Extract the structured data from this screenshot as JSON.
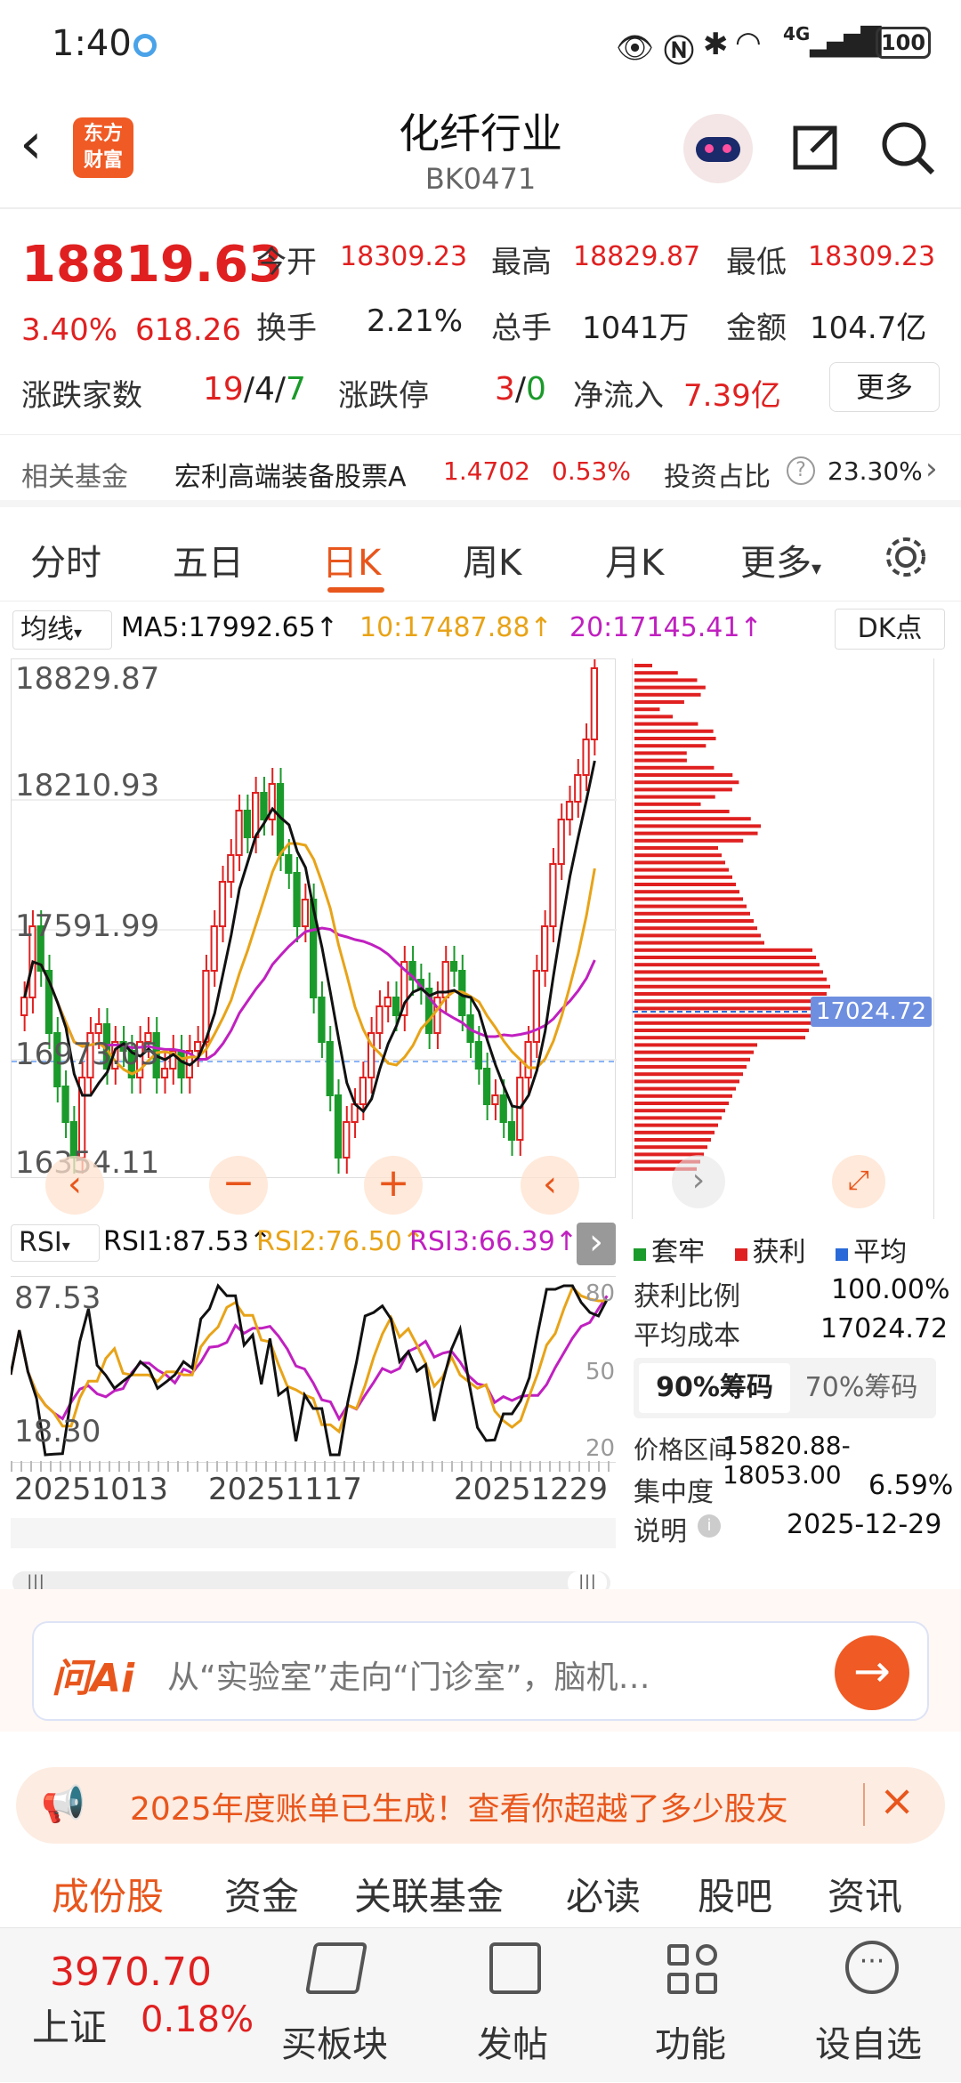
{
  "status": {
    "time": "1:40",
    "battery": "100",
    "network": "4G"
  },
  "header": {
    "title": "化纤行业",
    "code": "BK0471",
    "logo_line1": "东方",
    "logo_line2": "财富"
  },
  "quote": {
    "price": "18819.63",
    "pct": "3.40%",
    "chg": "618.26",
    "open_label": "今开",
    "open": "18309.23",
    "high_label": "最高",
    "high": "18829.87",
    "low_label": "最低",
    "low": "18309.23",
    "turnover_label": "换手",
    "turnover": "2.21%",
    "volume_label": "总手",
    "volume": "1041万",
    "amount_label": "金额",
    "amount": "104.7亿",
    "adv_label": "涨跌家数",
    "adv_up": "19",
    "adv_flat": "4",
    "adv_down": "7",
    "limit_label": "涨跌停",
    "limit_up": "3",
    "limit_down": "0",
    "netflow_label": "净流入",
    "netflow": "7.39亿",
    "more_btn": "更多"
  },
  "fund": {
    "label": "相关基金",
    "name": "宏利高端装备股票A",
    "nav": "1.4702",
    "pct": "0.53%",
    "ratio_label": "投资占比",
    "ratio": "23.30%"
  },
  "tabs": [
    {
      "label": "分时"
    },
    {
      "label": "五日"
    },
    {
      "label": "日K"
    },
    {
      "label": "周K"
    },
    {
      "label": "月K"
    },
    {
      "label": "更多"
    }
  ],
  "ma": {
    "selector": "均线",
    "ma5": "MA5:17992.65↑",
    "ma10": "10:17487.88↑",
    "ma20": "20:17145.41↑",
    "dk": "DK点"
  },
  "price_axis": [
    "18829.87",
    "18210.93",
    "17591.99",
    "16973.05",
    "16354.11"
  ],
  "rsi": {
    "selector": "RSI",
    "rsi1": "RSI1:87.53↑",
    "rsi2": "RSI2:76.50↑",
    "rsi3": "RSI3:66.39↑",
    "top": "87.53",
    "bottom": "18.30",
    "r80": "80",
    "r50": "50",
    "r20": "20"
  },
  "dates": [
    "20251013",
    "20251117",
    "20251229"
  ],
  "chips": {
    "cost_tag": "17024.72",
    "legend": [
      "套牢",
      "获利",
      "平均"
    ],
    "profit_label": "获利比例",
    "profit": "100.00%",
    "avg_label": "平均成本",
    "avg": "17024.72",
    "tab90": "90%筹码",
    "tab70": "70%筹码",
    "range_label": "价格区间",
    "range": "15820.88-18053.00",
    "conc_label": "集中度",
    "conc": "6.59%",
    "note_label": "说明",
    "note": "2025-12-29"
  },
  "ai": {
    "logo": "问Ai",
    "text": "从“实验室”走向“门诊室”，脑机…"
  },
  "promo": {
    "text": "2025年度账单已生成！查看你超越了多少股友"
  },
  "bottom_tabs": [
    {
      "label": "成份股"
    },
    {
      "label": "资金"
    },
    {
      "label": "关联基金"
    },
    {
      "label": "必读"
    },
    {
      "label": "股吧"
    },
    {
      "label": "资讯"
    }
  ],
  "index": {
    "value": "3970.70",
    "name": "上证",
    "pct": "0.18%"
  },
  "nav": [
    {
      "label": "买板块"
    },
    {
      "label": "发帖"
    },
    {
      "label": "功能"
    },
    {
      "label": "设自选"
    }
  ],
  "colors": {
    "up": "#e02020",
    "down": "#1a9a2a",
    "accent": "#e8561c",
    "ma5": "#111111",
    "ma10": "#e8a317",
    "ma20": "#c020c0"
  }
}
